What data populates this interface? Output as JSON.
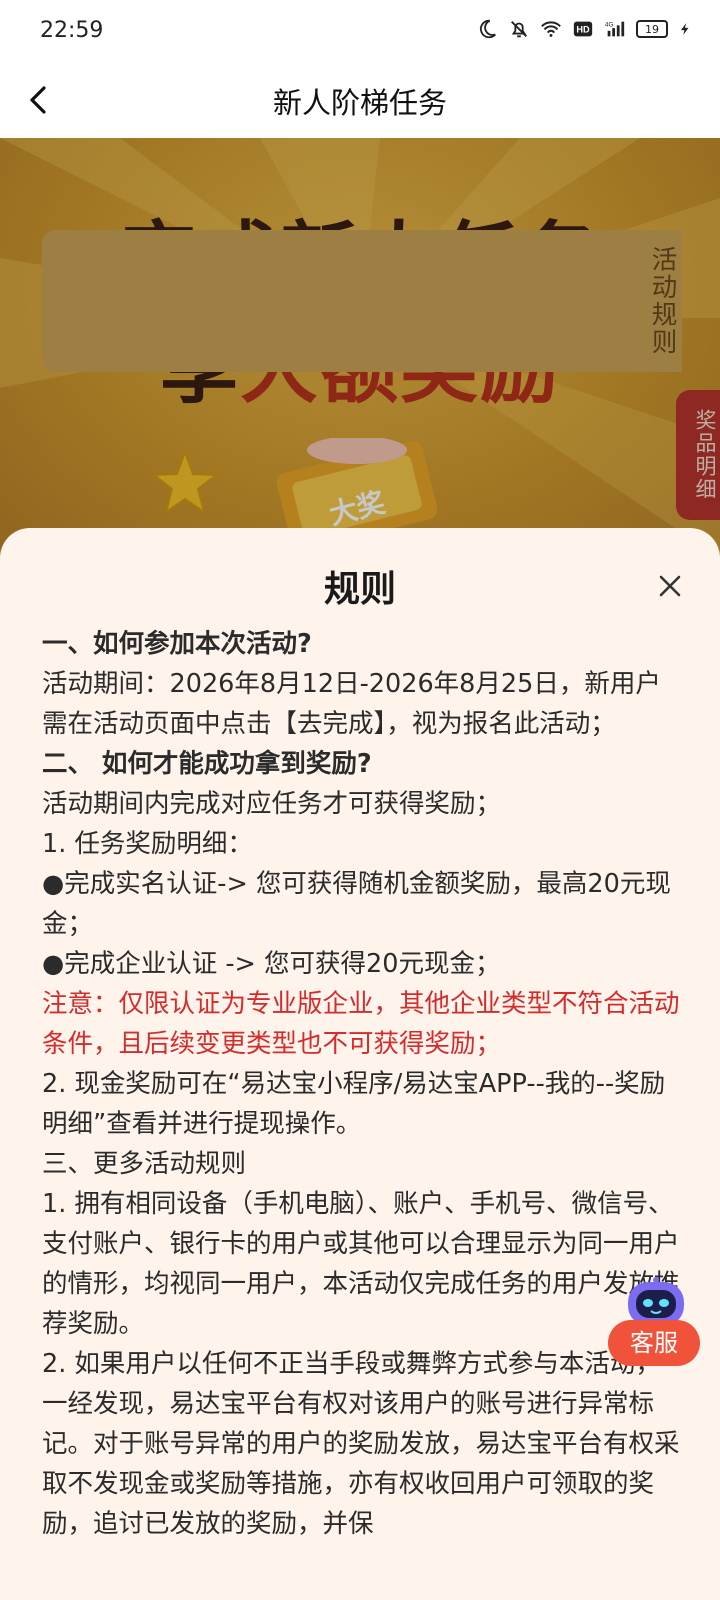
{
  "status_bar": {
    "time": "22:59",
    "battery": "19"
  },
  "header": {
    "title": "新人阶梯任务"
  },
  "hero": {
    "line1": "完成新人任务",
    "line2_prefix": "享",
    "line2_highlight": "大额奖励",
    "ticket_text": "大奖",
    "tab_rules": "活动规则",
    "tab_prizes": "奖品明细"
  },
  "sheet": {
    "title": "规则",
    "rules": [
      {
        "text": "一、如何参加本次活动?",
        "style": "sec"
      },
      {
        "text": "活动期间：2026年8月12日-2026年8月25日，新用户需在活动页面中点击【去完成】，视为报名此活动；",
        "style": "normal"
      },
      {
        "text": " 二、 如何才能成功拿到奖励?",
        "style": "sec"
      },
      {
        "text": "活动期间内完成对应任务才可获得奖励；",
        "style": "normal"
      },
      {
        "text": " 1. 任务奖励明细：",
        "style": "normal"
      },
      {
        "text": "●完成实名认证-> 您可获得随机金额奖励，最高20元现金；",
        "style": "normal"
      },
      {
        "text": "●完成企业认证 -> 您可获得20元现金；",
        "style": "normal"
      },
      {
        "text": "注意：仅限认证为专业版企业，其他企业类型不符合活动条件，且后续变更类型也不可获得奖励；",
        "style": "red"
      },
      {
        "text": " 2. 现金奖励可在“易达宝小程序/易达宝APP--我的--奖励明细”查看并进行提现操作。",
        "style": "normal"
      },
      {
        "text": "三、更多活动规则",
        "style": "normal"
      },
      {
        "text": "1. 拥有相同设备（手机电脑）、账户、手机号、微信号、支付账户、银行卡的用户或其他可以合理显示为同一用户的情形，均视同一用户，本活动仅完成任务的用户发放推荐奖励。",
        "style": "normal"
      },
      {
        "text": "2. 如果用户以任何不正当手段或舞弊方式参与本活动，一经发现，易达宝平台有权对该用户的账号进行异常标记。对于账号异常的用户的奖励发放，易达宝平台有权采取不发现金或奖励等措施，亦有权收回用户可领取的奖励，追讨已发放的奖励，并保",
        "style": "normal"
      }
    ]
  },
  "customer_service": {
    "label": "客服"
  }
}
